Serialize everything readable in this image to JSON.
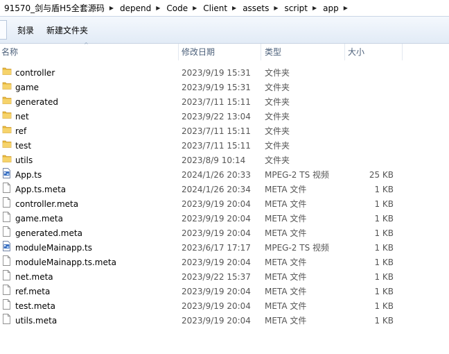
{
  "breadcrumb": [
    "91570_剑与盾H5全套源码",
    "depend",
    "Code",
    "Client",
    "assets",
    "script",
    "app"
  ],
  "toolbar": {
    "burn_label": "刻录",
    "new_folder_label": "新建文件夹"
  },
  "columns": {
    "name": "名称",
    "date": "修改日期",
    "type": "类型",
    "size": "大小"
  },
  "files": [
    {
      "name": "controller",
      "date": "2023/9/19 15:31",
      "type": "文件夹",
      "size": "",
      "icon": "folder-icon"
    },
    {
      "name": "game",
      "date": "2023/9/19 15:31",
      "type": "文件夹",
      "size": "",
      "icon": "folder-icon"
    },
    {
      "name": "generated",
      "date": "2023/7/11 15:11",
      "type": "文件夹",
      "size": "",
      "icon": "folder-icon"
    },
    {
      "name": "net",
      "date": "2023/9/22 13:04",
      "type": "文件夹",
      "size": "",
      "icon": "folder-icon"
    },
    {
      "name": "ref",
      "date": "2023/7/11 15:11",
      "type": "文件夹",
      "size": "",
      "icon": "folder-icon"
    },
    {
      "name": "test",
      "date": "2023/7/11 15:11",
      "type": "文件夹",
      "size": "",
      "icon": "folder-icon"
    },
    {
      "name": "utils",
      "date": "2023/8/9 10:14",
      "type": "文件夹",
      "size": "",
      "icon": "folder-icon"
    },
    {
      "name": "App.ts",
      "date": "2024/1/26 20:33",
      "type": "MPEG-2 TS 视频",
      "size": "25 KB",
      "icon": "video-file-icon"
    },
    {
      "name": "App.ts.meta",
      "date": "2024/1/26 20:34",
      "type": "META 文件",
      "size": "1 KB",
      "icon": "file-icon"
    },
    {
      "name": "controller.meta",
      "date": "2023/9/19 20:04",
      "type": "META 文件",
      "size": "1 KB",
      "icon": "file-icon"
    },
    {
      "name": "game.meta",
      "date": "2023/9/19 20:04",
      "type": "META 文件",
      "size": "1 KB",
      "icon": "file-icon"
    },
    {
      "name": "generated.meta",
      "date": "2023/9/19 20:04",
      "type": "META 文件",
      "size": "1 KB",
      "icon": "file-icon"
    },
    {
      "name": "moduleMainapp.ts",
      "date": "2023/6/17 17:17",
      "type": "MPEG-2 TS 视频",
      "size": "1 KB",
      "icon": "video-file-icon"
    },
    {
      "name": "moduleMainapp.ts.meta",
      "date": "2023/9/19 20:04",
      "type": "META 文件",
      "size": "1 KB",
      "icon": "file-icon"
    },
    {
      "name": "net.meta",
      "date": "2023/9/22 15:37",
      "type": "META 文件",
      "size": "1 KB",
      "icon": "file-icon"
    },
    {
      "name": "ref.meta",
      "date": "2023/9/19 20:04",
      "type": "META 文件",
      "size": "1 KB",
      "icon": "file-icon"
    },
    {
      "name": "test.meta",
      "date": "2023/9/19 20:04",
      "type": "META 文件",
      "size": "1 KB",
      "icon": "file-icon"
    },
    {
      "name": "utils.meta",
      "date": "2023/9/19 20:04",
      "type": "META 文件",
      "size": "1 KB",
      "icon": "file-icon"
    }
  ]
}
